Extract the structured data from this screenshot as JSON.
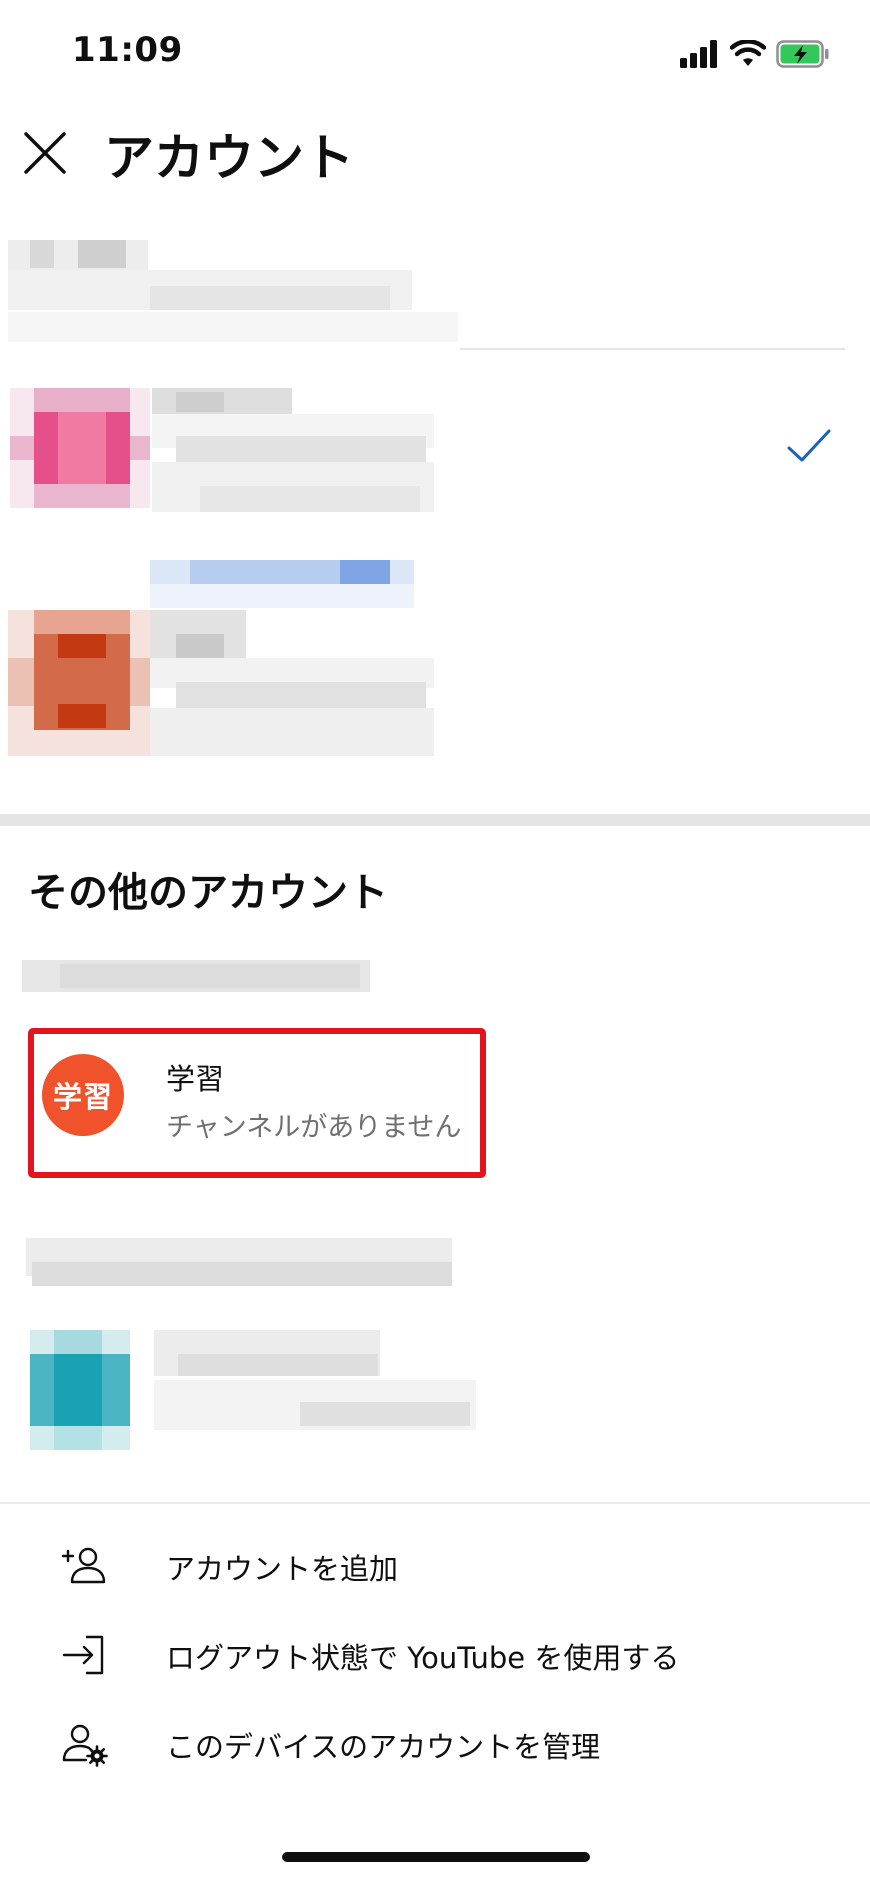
{
  "status_bar": {
    "time": "11:09"
  },
  "header": {
    "title": "アカウント"
  },
  "other_accounts": {
    "section_title": "その他のアカウント",
    "highlighted_account": {
      "avatar_text": "学習",
      "name": "学習",
      "subtitle": "チャンネルがありません"
    }
  },
  "actions": [
    {
      "label": "アカウントを追加",
      "icon": "add-person-icon"
    },
    {
      "label": "ログアウト状態で YouTube を使用する",
      "icon": "sign-in-arrow-icon"
    },
    {
      "label": "このデバイスのアカウントを管理",
      "icon": "person-gear-icon"
    }
  ],
  "colors": {
    "accent_blue": "#1c62b9",
    "highlight_red": "#e3141d",
    "avatar_orange": "#f0532b"
  }
}
